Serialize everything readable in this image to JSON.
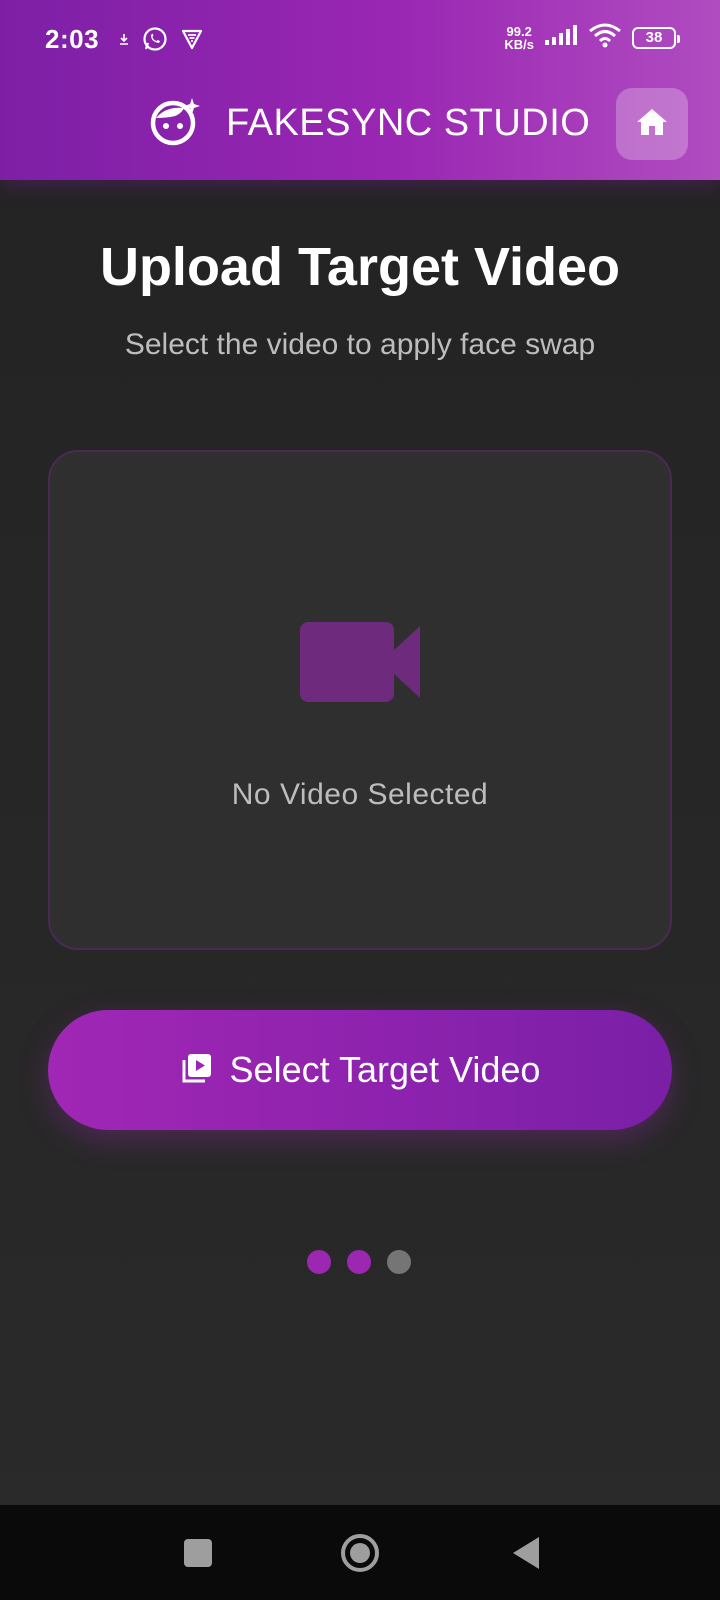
{
  "status_bar": {
    "time": "2:03",
    "net_speed_value": "99.2",
    "net_speed_unit": "KB/s",
    "battery": "38",
    "icons": [
      "download-icon",
      "whatsapp-icon",
      "vpn-shield-icon",
      "signal-icon",
      "wifi-icon",
      "battery-icon"
    ]
  },
  "header": {
    "title": "FAKESYNC STUDIO",
    "logo_icon": "face-sparkle-icon",
    "home_icon": "home-icon"
  },
  "main": {
    "title": "Upload Target Video",
    "subtitle": "Select the video to apply face swap",
    "preview": {
      "icon": "video-camera-icon",
      "empty_text": "No Video Selected"
    },
    "select_button": {
      "label": "Select Target Video",
      "icon": "video-library-icon"
    },
    "steps": {
      "total": 3,
      "completed": 2,
      "active_color": "#9c27b0",
      "inactive_color": "#757575"
    }
  },
  "nav_bar": {
    "icons": [
      "recents-square-icon",
      "home-circle-icon",
      "back-triangle-icon"
    ]
  },
  "colors": {
    "accent": "#9c27b0",
    "background": "#262626",
    "card": "#2f2f2f"
  }
}
